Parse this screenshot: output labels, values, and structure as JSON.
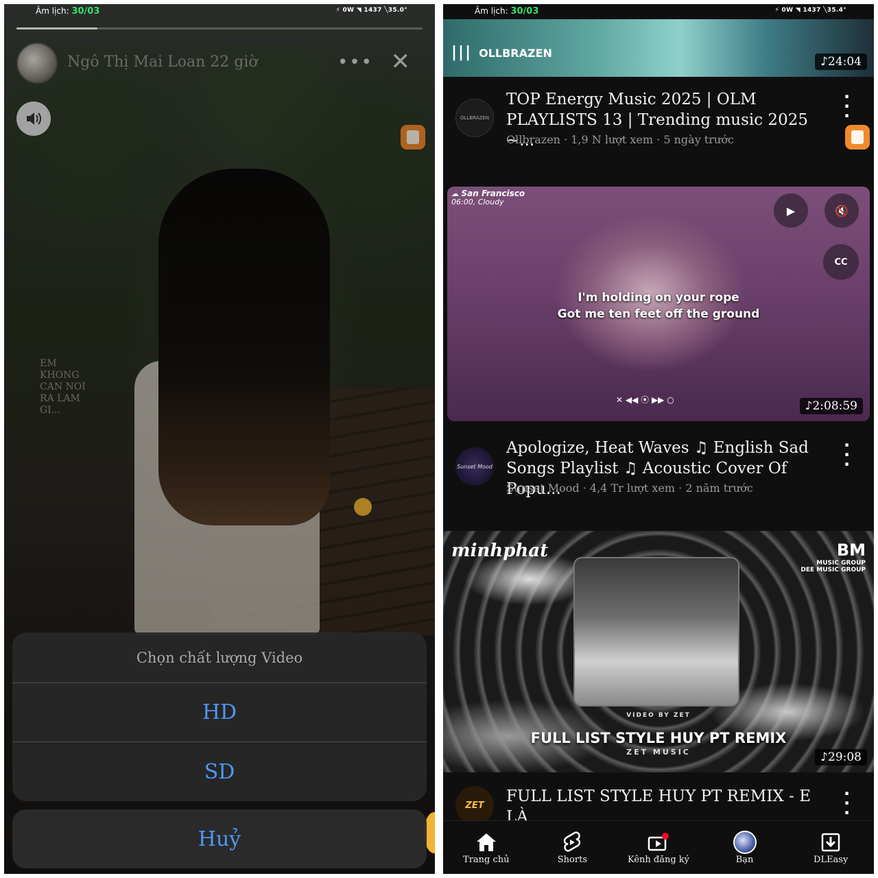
{
  "left": {
    "status_lunar_label": "Âm lịch:",
    "status_lunar_date": "30/03",
    "status_system": "⚡ 0W  ◥ 1437  ╲35.0°",
    "story": {
      "progress": 0.2,
      "author_name": "Ngô Thị Mai Loan",
      "time_ago": "22 giờ",
      "more_label": "•••",
      "close_label": "✕",
      "caption_lines": [
        "EM",
        "KHONG",
        "CAN NOI",
        "RA LAM",
        "GI..."
      ]
    },
    "sheet": {
      "title": "Chọn chất lượng Video",
      "options": [
        "HD",
        "SD"
      ],
      "cancel": "Huỷ"
    }
  },
  "right": {
    "status_lunar_label": "Âm lịch:",
    "status_lunar_date": "30/03",
    "status_system": "⚡ 0W  ◥ 1437  ╲35.4°",
    "videos": [
      {
        "thumb_channel_art": "OLLBRAZEN",
        "duration": "24:04",
        "title": "TOP Energy Music 2025 | OLM\nPLAYLISTS 13 | Trending music 2025 ~...",
        "meta": "Ollbrazen · 1,9 N lượt xem · 5 ngày trước",
        "avatar_text": "OLLBRAZEN"
      },
      {
        "weather_city": "San Francisco",
        "weather_detail": "06:00, Cloudy",
        "lyrics_line1": "I'm holding on your rope",
        "lyrics_line2": "Got me ten feet off the ground",
        "player_controls": "✕  ◀◀  ⦿  ▶▶  ○",
        "cc_label": "CC",
        "duration": "2:08:59",
        "title": "Apologize, Heat Waves ♫ English Sad\nSongs Playlist ♫ Acoustic Cover Of Popu...",
        "meta": "Sunset Mood · 4,4 Tr lượt xem · 2 năm trước",
        "avatar_text": "Sunset Mood"
      },
      {
        "brand_left": "minhphat",
        "brand_right": "BM",
        "brand_right_sub": "MUSIC GROUP",
        "brand_right_sub2": "DEE MUSIC GROUP",
        "video_by": "VIDEO BY ZET",
        "poster_title": "FULL LIST STYLE HUY PT REMIX",
        "poster_sub": "ZET MUSIC",
        "duration": "29:08",
        "title": "FULL LIST STYLE HUY PT REMIX - E LÀ\nKHÔNG THỂ X MƯA RƠI VÀO PHÒN...",
        "avatar_text": "ZET"
      }
    ],
    "nav": [
      {
        "label": "Trang chủ",
        "icon": "home-icon"
      },
      {
        "label": "Shorts",
        "icon": "shorts-icon"
      },
      {
        "label": "Kênh đăng ký",
        "icon": "subscriptions-icon"
      },
      {
        "label": "Bạn",
        "icon": "profile-avatar"
      },
      {
        "label": "DLEasy",
        "icon": "download-icon"
      }
    ],
    "accent_red": "#ff0033"
  },
  "colors": {
    "ios_blue": "#4e97f5",
    "lunar_green": "#35e06a",
    "app_orange": "#f08a2c"
  }
}
